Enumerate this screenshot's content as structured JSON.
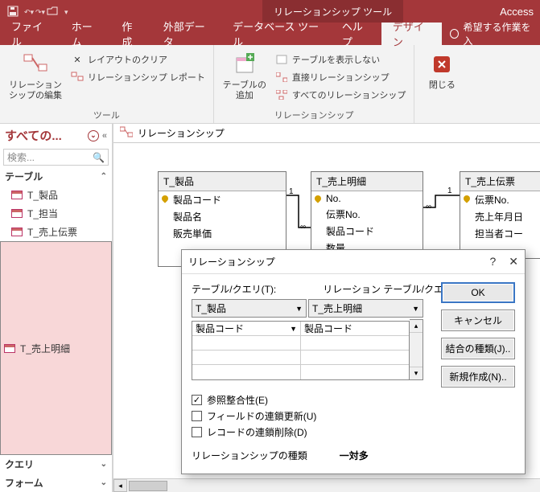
{
  "qat": {
    "save": "save",
    "undo": "undo",
    "open": "open"
  },
  "context_tab": "リレーションシップ ツール",
  "app_name": "Access",
  "tabs": {
    "file": "ファイル",
    "home": "ホーム",
    "create": "作成",
    "external": "外部データ",
    "dbtools": "データベース ツール",
    "help": "ヘルプ",
    "design": "デザイン"
  },
  "tellme": "希望する作業を入",
  "ribbon": {
    "edit_rel": "リレーションシップの編集",
    "clear_layout": "レイアウトのクリア",
    "rel_report": "リレーションシップ レポート",
    "group_tools": "ツール",
    "add_tables": "テーブルの追加",
    "hide_table": "テーブルを表示しない",
    "direct_rel": "直接リレーションシップ",
    "all_rel": "すべてのリレーションシップ",
    "group_rel": "リレーションシップ",
    "close": "閉じる"
  },
  "nav": {
    "title": "すべての...",
    "search_ph": "検索...",
    "sec_table": "テーブル",
    "items": [
      "T_製品",
      "T_担当",
      "T_売上伝票",
      "T_売上明細"
    ],
    "sec_query": "クエリ",
    "sec_form": "フォーム"
  },
  "doc_tab": "リレーションシップ",
  "entities": {
    "e1": {
      "title": "T_製品",
      "fields": [
        "製品コード",
        "製品名",
        "販売単価"
      ]
    },
    "e2": {
      "title": "T_売上明細",
      "fields": [
        "No.",
        "伝票No.",
        "製品コード",
        "数量"
      ]
    },
    "e3": {
      "title": "T_売上伝票",
      "fields": [
        "伝票No.",
        "売上年月日",
        "担当者コー"
      ]
    }
  },
  "dialog": {
    "title": "リレーションシップ",
    "tbl_query": "テーブル/クエリ(T):",
    "rel_tbl_query": "リレーション テーブル/クエリ(R):",
    "left_sel": "T_製品",
    "right_sel": "T_売上明細",
    "left_field": "製品コード",
    "right_field": "製品コード",
    "ok": "OK",
    "cancel": "キャンセル",
    "join": "結合の種類(J)..",
    "new": "新規作成(N)..",
    "chk_integrity": "参照整合性(E)",
    "chk_cascade_u": "フィールドの連鎖更新(U)",
    "chk_cascade_d": "レコードの連鎖削除(D)",
    "reltype_lbl": "リレーションシップの種類",
    "reltype_val": "一対多"
  },
  "chart_data": null
}
